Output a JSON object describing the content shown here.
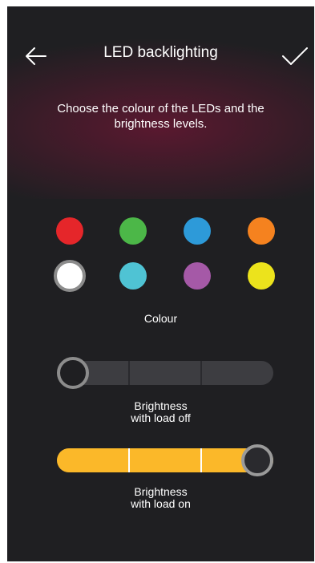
{
  "header": {
    "title": "LED backlighting",
    "back_icon": "arrow-left-icon",
    "confirm_icon": "checkmark-icon"
  },
  "instructions": "Choose the colour of the LEDs and the brightness levels.",
  "colour": {
    "label": "Colour",
    "swatches": [
      {
        "name": "red",
        "color": "#e5262a",
        "selected": false
      },
      {
        "name": "green",
        "color": "#4cb748",
        "selected": false
      },
      {
        "name": "blue",
        "color": "#2d9ad9",
        "selected": false
      },
      {
        "name": "orange",
        "color": "#f5821f",
        "selected": false
      },
      {
        "name": "white",
        "color": "#ffffff",
        "selected": true
      },
      {
        "name": "cyan",
        "color": "#4fc3d4",
        "selected": false
      },
      {
        "name": "purple",
        "color": "#a559a7",
        "selected": false
      },
      {
        "name": "yellow",
        "color": "#ece31c",
        "selected": false
      }
    ]
  },
  "brightness_off": {
    "label_line1": "Brightness",
    "label_line2": "with load off",
    "level": 0,
    "steps": 3
  },
  "brightness_on": {
    "label_line1": "Brightness",
    "label_line2": "with load on",
    "level": 3,
    "steps": 3
  },
  "colors": {
    "background": "#1f1f22",
    "accent": "#fbb829",
    "track": "#3d3d41"
  }
}
